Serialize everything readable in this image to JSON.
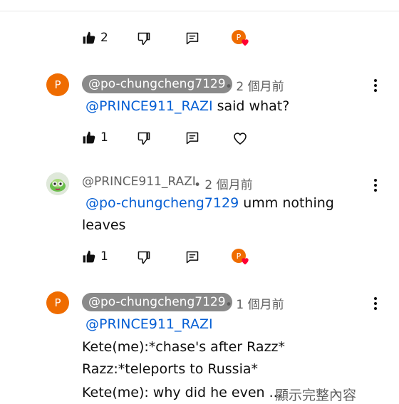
{
  "comments": [
    {
      "actions": {
        "like_count": "2"
      }
    },
    {
      "avatar_letter": "P",
      "author": "@po-chungcheng7129",
      "time": "• 2 個月前",
      "mention": "@PRINCE911_RAZI",
      "body": "said what?",
      "actions": {
        "like_count": "1"
      }
    },
    {
      "author": "@PRINCE911_RAZI",
      "time": "• 2 個月前",
      "mention": "@po-chungcheng7129",
      "body": "umm nothing",
      "body_line2": "leaves",
      "actions": {
        "like_count": "1"
      }
    },
    {
      "avatar_letter": "P",
      "author": "@po-chungcheng7129",
      "time": "• 1 個月前",
      "mention": "@PRINCE911_RAZI",
      "lines": [
        "Kete(me):*chase's after Razz*",
        "Razz:*teleports to Russia*",
        "Kete(me): why did he even ..."
      ],
      "show_more": "顯示完整內容"
    }
  ],
  "creator_badge_letter": "P",
  "colors": {
    "accent": "#065fd4",
    "avatar": "#ef6c00",
    "heart": "#ff0033",
    "pill": "#8a8a8a"
  }
}
